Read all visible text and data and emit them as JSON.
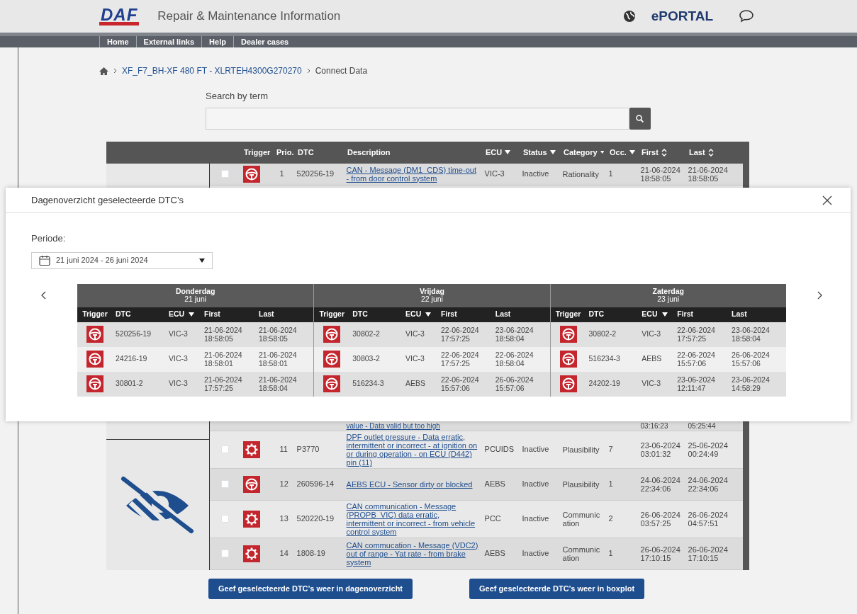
{
  "header": {
    "logo": "DAF",
    "title": "Repair & Maintenance Information",
    "portal": "ePORTAL"
  },
  "nav": [
    {
      "label": "Home"
    },
    {
      "label": "External links"
    },
    {
      "label": "Help"
    },
    {
      "label": "Dealer cases"
    }
  ],
  "breadcrumb": [
    {
      "label": "XF_F7_BH-XF 480 FT - XLRTEH4300G270270",
      "link": true
    },
    {
      "label": "Connect Data",
      "link": false
    }
  ],
  "search": {
    "label": "Search by term"
  },
  "table": {
    "columns": [
      {
        "label": "Trigger",
        "kind": "plain"
      },
      {
        "label": "Prio.",
        "kind": "plain"
      },
      {
        "label": "DTC",
        "kind": "plain"
      },
      {
        "label": "Description",
        "kind": "plain"
      },
      {
        "label": "ECU",
        "kind": "filter"
      },
      {
        "label": "Status",
        "kind": "filter"
      },
      {
        "label": "Category",
        "kind": "filter"
      },
      {
        "label": "Occ.",
        "kind": "filter"
      },
      {
        "label": "First",
        "kind": "sort"
      },
      {
        "label": "Last",
        "kind": "sort"
      }
    ],
    "rows": [
      {
        "kind": "wheel",
        "checked": false,
        "prio": "1",
        "dtc": "520256-19",
        "description": "CAN - Message (DM1_CDS) time-out - from door control system",
        "ecu": "VIC-3",
        "status": "Inactive",
        "category": "Rationality",
        "occ": "1",
        "first": "21-06-2024 18:58:05",
        "last": "21-06-2024 18:58:05"
      },
      {
        "kind": "gear",
        "checked": false,
        "prio": "11",
        "dtc": "P3770",
        "description": "DPF outlet pressure - Data erratic, intermittent or incorrect - at ignition on or during operation - on ECU (D442) pin (11)",
        "ecu": "PCUIDS",
        "status": "Inactive",
        "category": "Plausibility",
        "occ": "7",
        "first": "23-06-2024 03:01:32",
        "last": "25-06-2024 00:24:49"
      },
      {
        "kind": "wheel",
        "checked": false,
        "prio": "12",
        "dtc": "260596-14",
        "description": "AEBS ECU - Sensor dirty or blocked",
        "ecu": "AEBS",
        "status": "Inactive",
        "category": "Plausibility",
        "occ": "1",
        "first": "24-06-2024 22:34:06",
        "last": "24-06-2024 22:34:06"
      },
      {
        "kind": "gear",
        "checked": false,
        "prio": "13",
        "dtc": "520220-19",
        "description": "CAN communication - Message (PROPB_VIC) data erratic, intermittent or incorrect - from vehicle control system",
        "ecu": "PCC",
        "status": "Inactive",
        "category": "Communication",
        "occ": "2",
        "first": "26-06-2024 03:57:25",
        "last": "26-06-2024 04:57:51"
      },
      {
        "kind": "gear",
        "checked": false,
        "prio": "14",
        "dtc": "1808-19",
        "description": "CAN commucation - Message (VDC2) out of range - Yat rate - from brake system",
        "ecu": "AEBS",
        "status": "Inactive",
        "category": "Communication",
        "occ": "1",
        "first": "26-06-2024 17:10:15",
        "last": "26-06-2024 17:10:15"
      }
    ],
    "partial_row": {
      "description": "value - Data valid but too high",
      "first": "03:16:23",
      "last": "05:25:44"
    }
  },
  "buttons": [
    {
      "label": "Geef geselecteerde DTC’s weer in dagenoverzicht"
    },
    {
      "label": "Geef geselecteerde DTC’s weer in boxplot"
    }
  ],
  "modal": {
    "title": "Dagenoverzicht geselecteerde DTC’s",
    "period_label": "Periode:",
    "period_value": "21 juni 2024 - 26 juni 2024",
    "days": [
      {
        "day": "Donderdag",
        "date": "21 juni",
        "columns": [
          {
            "label": "Trigger",
            "kind": "plain"
          },
          {
            "label": "DTC",
            "kind": "plain"
          },
          {
            "label": "ECU",
            "kind": "filter"
          },
          {
            "label": "First",
            "kind": "plain"
          },
          {
            "label": "Last",
            "kind": "plain"
          }
        ],
        "rows": [
          {
            "kind": "wheel",
            "dtc": "520256-19",
            "ecu": "VIC-3",
            "first": "21-06-2024 18:58:05",
            "last": "21-06-2024 18:58:05"
          },
          {
            "kind": "wheel",
            "dtc": "24216-19",
            "ecu": "VIC-3",
            "first": "21-06-2024 18:58:01",
            "last": "21-06-2024 18:58:01"
          },
          {
            "kind": "wheel",
            "dtc": "30801-2",
            "ecu": "VIC-3",
            "first": "21-06-2024 17:57:25",
            "last": "21-06-2024 18:58:04"
          }
        ]
      },
      {
        "day": "Vrijdag",
        "date": "22 juni",
        "columns": [
          {
            "label": "Trigger",
            "kind": "plain"
          },
          {
            "label": "DTC",
            "kind": "plain"
          },
          {
            "label": "ECU",
            "kind": "filter"
          },
          {
            "label": "First",
            "kind": "plain"
          },
          {
            "label": "Last",
            "kind": "plain"
          }
        ],
        "rows": [
          {
            "kind": "wheel",
            "dtc": "30802-2",
            "ecu": "VIC-3",
            "first": "22-06-2024 17:57:25",
            "last": "23-06-2024 18:58:04"
          },
          {
            "kind": "wheel",
            "dtc": "30803-2",
            "ecu": "VIC-3",
            "first": "22-06-2024 17:57:25",
            "last": "22-06-2024 18:58:04"
          },
          {
            "kind": "wheel",
            "dtc": "516234-3",
            "ecu": "AEBS",
            "first": "22-06-2024 15:57:06",
            "last": "26-06-2024 15:57:06"
          }
        ]
      },
      {
        "day": "Zaterdag",
        "date": "23 juni",
        "columns": [
          {
            "label": "Trigger",
            "kind": "plain"
          },
          {
            "label": "DTC",
            "kind": "plain"
          },
          {
            "label": "ECU",
            "kind": "filter"
          },
          {
            "label": "First",
            "kind": "plain"
          },
          {
            "label": "Last",
            "kind": "plain"
          }
        ],
        "rows": [
          {
            "kind": "wheel",
            "dtc": "30802-2",
            "ecu": "VIC-3",
            "first": "22-06-2024 17:57:25",
            "last": "23-06-2024 18:58:04"
          },
          {
            "kind": "wheel",
            "dtc": "516234-3",
            "ecu": "AEBS",
            "first": "22-06-2024 15:57:06",
            "last": "26-06-2024 15:57:06"
          },
          {
            "kind": "wheel",
            "dtc": "24202-19",
            "ecu": "VIC-3",
            "first": "23-06-2024 12:11:47",
            "last": "23-06-2024 14:58:29"
          }
        ]
      }
    ]
  }
}
